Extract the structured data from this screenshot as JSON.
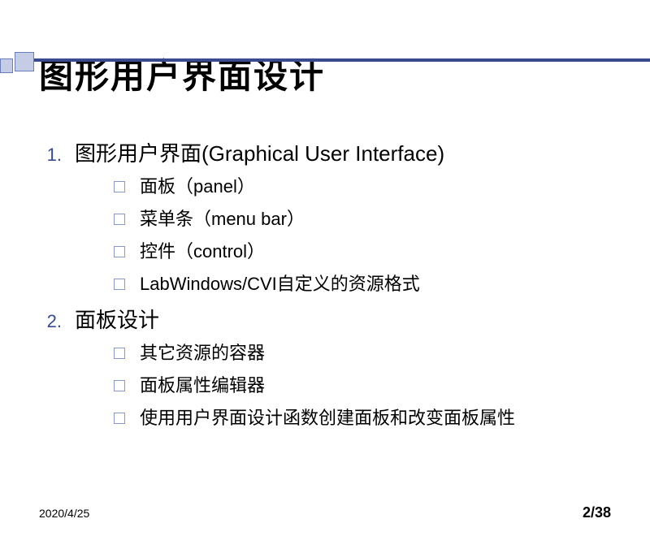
{
  "title": "图形用户界面设计",
  "items": [
    {
      "num": "1.",
      "text": "图形用户界面(Graphical User Interface)",
      "subs": [
        "面板（panel）",
        "菜单条（menu bar）",
        "控件（control）",
        "LabWindows/CVI自定义的资源格式"
      ]
    },
    {
      "num": "2.",
      "text": "面板设计",
      "subs": [
        "其它资源的容器",
        "面板属性编辑器",
        "使用用户界面设计函数创建面板和改变面板属性"
      ]
    }
  ],
  "footer": {
    "date": "2020/4/25",
    "page": "2/38"
  }
}
